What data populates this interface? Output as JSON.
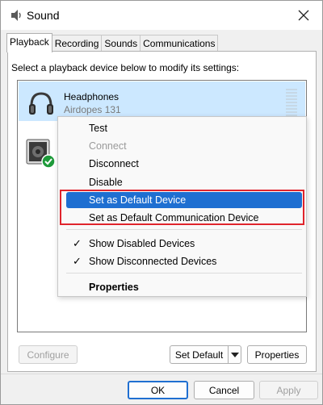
{
  "window": {
    "title": "Sound",
    "close_icon": "close-icon"
  },
  "tabs": [
    {
      "label": "Playback",
      "active": true
    },
    {
      "label": "Recording",
      "active": false
    },
    {
      "label": "Sounds",
      "active": false
    },
    {
      "label": "Communications",
      "active": false
    }
  ],
  "instruction": "Select a playback device below to modify its settings:",
  "devices": [
    {
      "name": "Headphones",
      "subtitle": "Airdopes 131",
      "icon": "headphones-icon",
      "selected": true
    },
    {
      "name": "",
      "subtitle": "",
      "icon": "speaker-icon",
      "default_badge": "green-check-icon",
      "selected": false
    }
  ],
  "context_menu": {
    "items": [
      {
        "label": "Test",
        "disabled": false
      },
      {
        "label": "Connect",
        "disabled": true
      },
      {
        "label": "Disconnect",
        "disabled": false
      },
      {
        "label": "Disable",
        "disabled": false
      },
      {
        "label": "Set as Default Device",
        "highlighted": true
      },
      {
        "label": "Set as Default Communication Device",
        "highlighted": false
      },
      {
        "label": "Show Disabled Devices",
        "checked": true
      },
      {
        "label": "Show Disconnected Devices",
        "checked": true
      },
      {
        "label": "Properties",
        "bold": true
      }
    ],
    "check_glyph": "✓"
  },
  "buttons": {
    "configure": "Configure",
    "set_default": "Set Default",
    "properties": "Properties",
    "ok": "OK",
    "cancel": "Cancel",
    "apply": "Apply"
  },
  "colors": {
    "selection": "#cce8ff",
    "menu_highlight": "#1f6fd1",
    "annotation_box": "#e0242c",
    "default_badge": "#1e9a3a"
  }
}
